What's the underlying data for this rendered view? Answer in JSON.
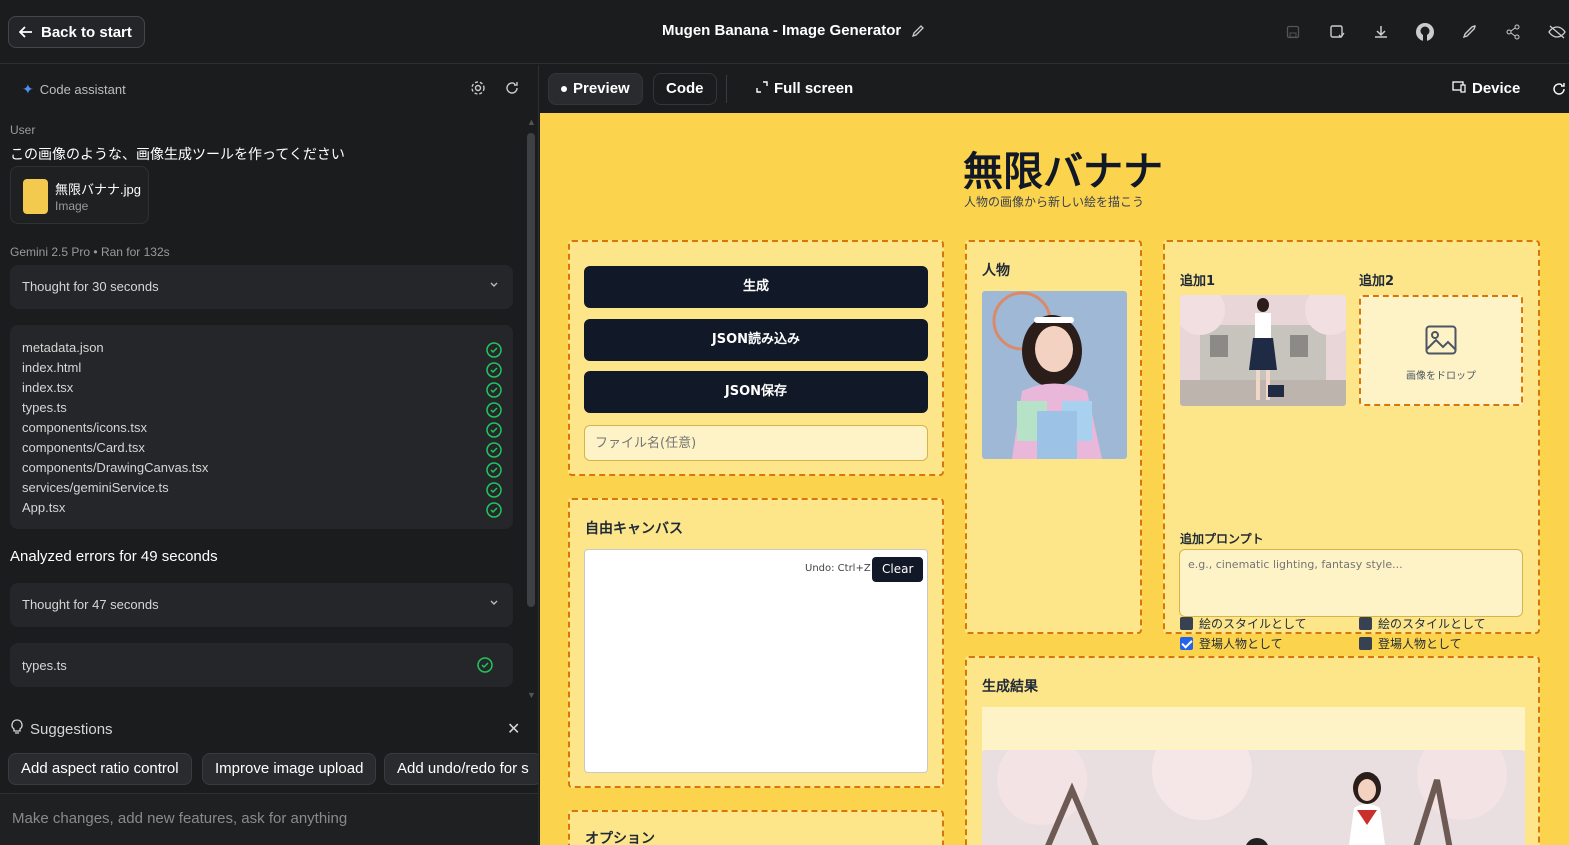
{
  "topbar": {
    "back_label": "Back to start",
    "title": "Mugen Banana - Image Generator",
    "icons": [
      "save-icon",
      "save-as-icon",
      "download-icon",
      "github-icon",
      "deploy-icon",
      "share-icon",
      "hide-icon"
    ]
  },
  "assistant": {
    "header": "Code assistant",
    "user_label": "User",
    "user_message": "この画像のような、画像生成ツールを作ってください",
    "attachment": {
      "name": "無限バナナ.jpg",
      "type": "Image"
    },
    "model": "Gemini 2.5 Pro",
    "ran_for": "Ran for 132s",
    "thought1": "Thought for 30 seconds",
    "files": [
      "metadata.json",
      "index.html",
      "index.tsx",
      "types.ts",
      "components/icons.tsx",
      "components/Card.tsx",
      "components/DrawingCanvas.tsx",
      "services/geminiService.ts",
      "App.tsx"
    ],
    "analyzed": "Analyzed errors for 49 seconds",
    "thought2": "Thought for 47 seconds",
    "file_last": "types.ts",
    "suggestions_label": "Suggestions",
    "suggestions": [
      "Add aspect ratio control",
      "Improve image upload",
      "Add undo/redo for s"
    ],
    "prompt_placeholder": "Make changes, add new features, ask for anything"
  },
  "toolbar": {
    "preview": "Preview",
    "code": "Code",
    "fullscreen": "Full screen",
    "device": "Device"
  },
  "app": {
    "title": "無限バナナ",
    "subtitle": "人物の画像から新しい絵を描こう",
    "buttons": {
      "generate": "生成",
      "load_json": "JSON読み込み",
      "save_json": "JSON保存"
    },
    "filename_placeholder": "ファイル名(任意)",
    "canvas": {
      "title": "自由キャンバス",
      "undo_hint": "Undo: Ctrl+Z",
      "clear": "Clear"
    },
    "options_title": "オプション",
    "person_title": "人物",
    "extra1": "追加1",
    "extra2": "追加2",
    "drop_text": "画像をドロップ",
    "extra_prompt_label": "追加プロンプト",
    "extra_prompt_placeholder": "e.g., cinematic lighting, fantasy style...",
    "style_label": "絵のスタイルとして",
    "character_label": "登場人物として",
    "result_title": "生成結果"
  }
}
